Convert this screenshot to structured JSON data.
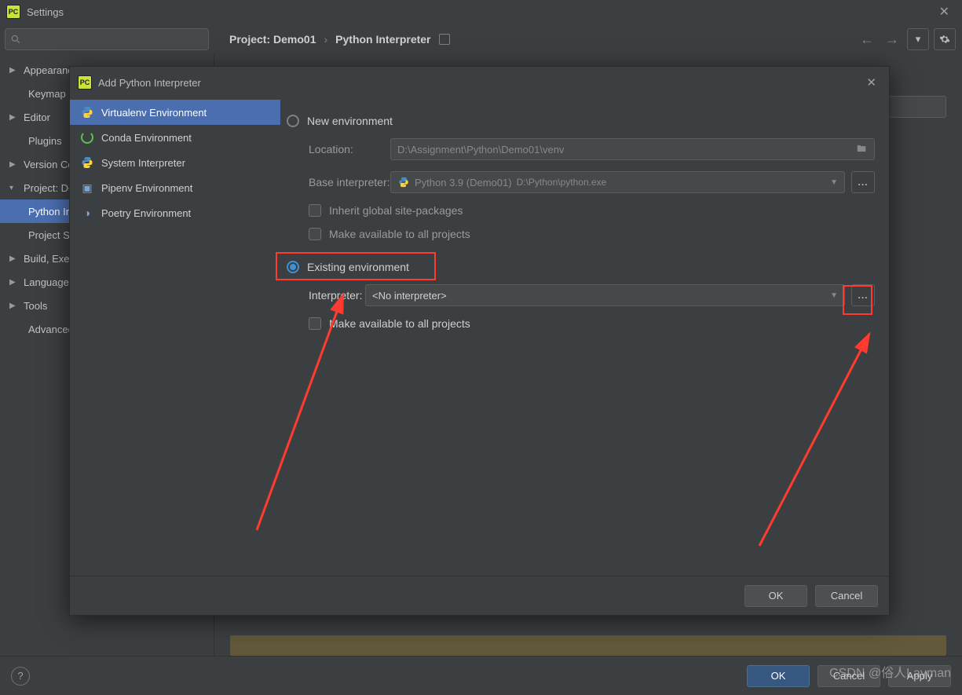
{
  "settings": {
    "title": "Settings",
    "breadcrumb": {
      "project": "Project: Demo01",
      "section": "Python Interpreter"
    },
    "tree": {
      "appearance": "Appearance & Behavior",
      "keymap": "Keymap",
      "editor": "Editor",
      "plugins": "Plugins",
      "versioncontrol": "Version Control",
      "project": "Project: Demo01",
      "pythoninterp": "Python Interpreter",
      "projectstructure": "Project Structure",
      "build": "Build, Execution, Deployment",
      "languages": "Languages & Frameworks",
      "tools": "Tools",
      "advanced": "Advanced Settings"
    },
    "footer": {
      "ok": "OK",
      "cancel": "Cancel",
      "apply": "Apply"
    }
  },
  "modal": {
    "title": "Add Python Interpreter",
    "envs": {
      "virtualenv": "Virtualenv Environment",
      "conda": "Conda Environment",
      "system": "System Interpreter",
      "pipenv": "Pipenv Environment",
      "poetry": "Poetry Environment"
    },
    "form": {
      "new_env": "New environment",
      "location_label": "Location:",
      "location_value": "D:\\Assignment\\Python\\Demo01\\venv",
      "base_label": "Base interpreter:",
      "base_value": "Python 3.9 (Demo01)",
      "base_path": "D:\\Python\\python.exe",
      "inherit": "Inherit global site-packages",
      "make_available": "Make available to all projects",
      "existing_env": "Existing environment",
      "interpreter_label": "Interpreter:",
      "interpreter_value": "<No interpreter>",
      "make_available2": "Make available to all projects"
    },
    "footer": {
      "ok": "OK",
      "cancel": "Cancel"
    }
  },
  "watermark": "CSDN @俗人Layman"
}
